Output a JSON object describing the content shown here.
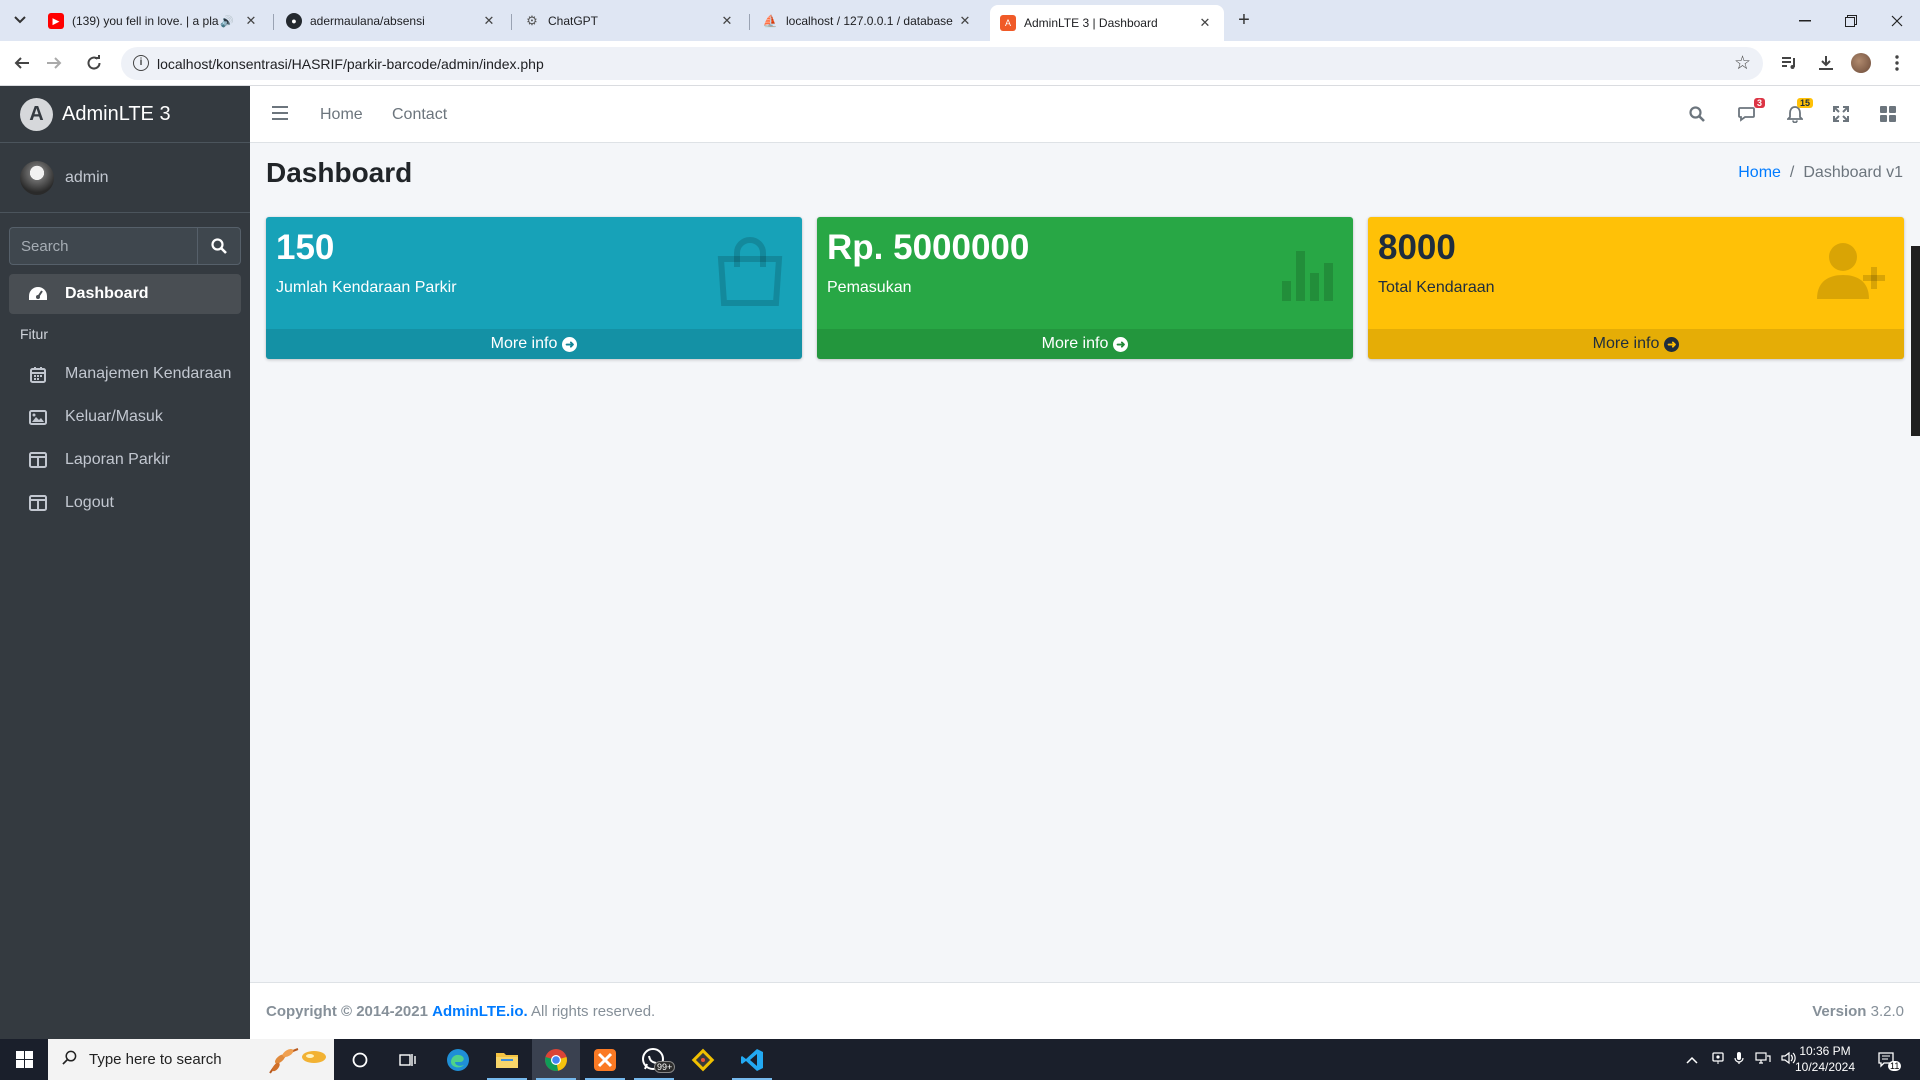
{
  "browser": {
    "tabs": [
      {
        "title": "(139) you fell in love. | a pla",
        "favicon": "youtube-icon"
      },
      {
        "title": "adermaulana/absensi",
        "favicon": "github-icon"
      },
      {
        "title": "ChatGPT",
        "favicon": "chatgpt-icon"
      },
      {
        "title": "localhost / 127.0.0.1 / database",
        "favicon": "phpmyadmin-icon"
      },
      {
        "title": "AdminLTE 3 | Dashboard",
        "favicon": "adminlte-icon"
      }
    ],
    "url": "localhost/konsentrasi/HASRIF/parkir-barcode/admin/index.php"
  },
  "sidebar": {
    "brand": "AdminLTE 3",
    "user": "admin",
    "search_placeholder": "Search",
    "section_header": "Fitur",
    "items": [
      {
        "label": "Dashboard",
        "icon": "dashboard-icon"
      },
      {
        "label": "Manajemen Kendaraan",
        "icon": "calendar-icon"
      },
      {
        "label": "Keluar/Masuk",
        "icon": "image-icon"
      },
      {
        "label": "Laporan Parkir",
        "icon": "table-icon"
      },
      {
        "label": "Logout",
        "icon": "table-icon"
      }
    ]
  },
  "navbar": {
    "links": [
      "Home",
      "Contact"
    ],
    "messages_badge": "3",
    "notifications_badge": "15"
  },
  "page": {
    "title": "Dashboard",
    "breadcrumb": [
      "Home",
      "Dashboard v1"
    ]
  },
  "cards": [
    {
      "value": "150",
      "label": "Jumlah Kendaraan Parkir",
      "footer": "More info",
      "color": "#17a2b8",
      "icon": "shopping-bag-icon"
    },
    {
      "value": "Rp. 5000000",
      "label": "Pemasukan",
      "footer": "More info",
      "color": "#28a745",
      "icon": "bar-chart-icon"
    },
    {
      "value": "8000",
      "label": "Total Kendaraan",
      "footer": "More info",
      "color": "#ffc107",
      "icon": "user-plus-icon"
    }
  ],
  "footer": {
    "copyright": "Copyright © 2014-2021",
    "link": "AdminLTE.io.",
    "rights": "All rights reserved.",
    "version_label": "Version",
    "version": "3.2.0"
  },
  "taskbar": {
    "search_placeholder": "Type here to search",
    "whatsapp_badge": "99+",
    "time": "10:36 PM",
    "date": "10/24/2024",
    "notification_count": "11"
  }
}
